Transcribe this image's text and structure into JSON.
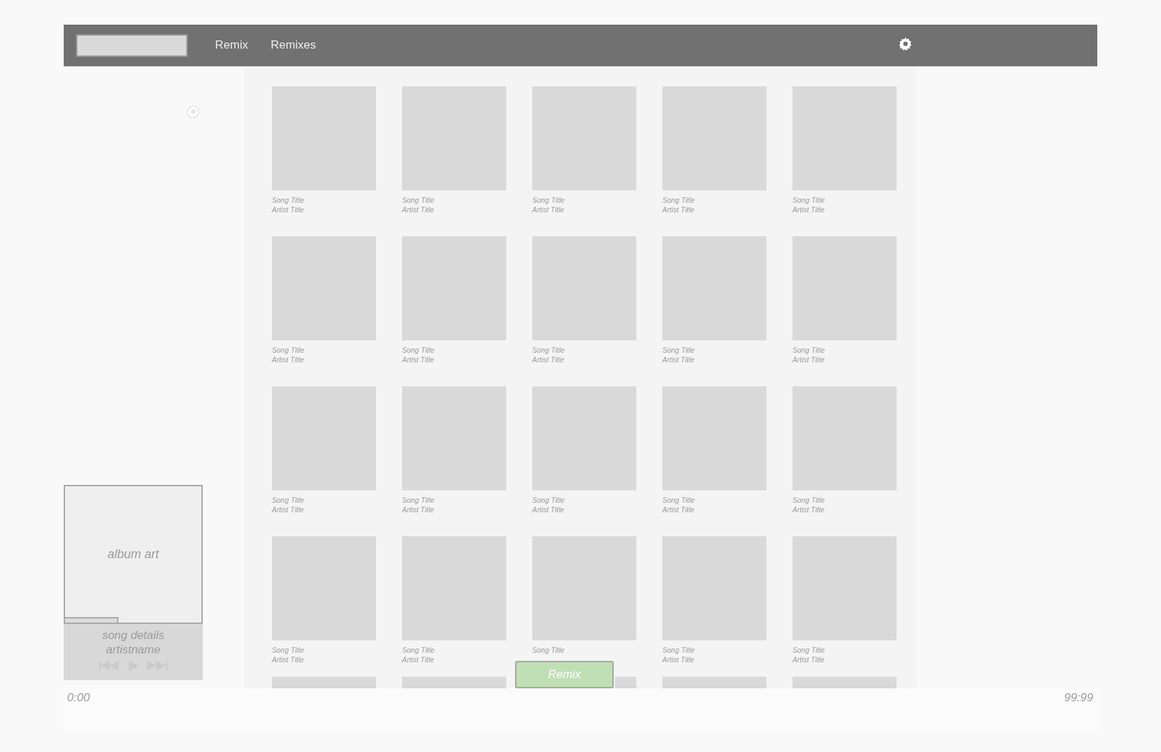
{
  "nav": {
    "items": [
      "Remix",
      "Remixes"
    ]
  },
  "player": {
    "album_art": "album art",
    "song": "song details",
    "artist": "artistname",
    "level": 0.39
  },
  "tiles": [
    {
      "kind": "song",
      "title": "Song Title",
      "artist": "Artist Title"
    },
    {
      "kind": "song",
      "title": "Song Title",
      "artist": "Artist Title"
    },
    {
      "kind": "song",
      "title": "Song Title",
      "artist": "Artist Title"
    },
    {
      "kind": "song",
      "title": "Song Title",
      "artist": "Artist Title"
    },
    {
      "kind": "song",
      "title": "Song Title",
      "artist": "Artist Title"
    },
    {
      "kind": "song",
      "title": "Song Title",
      "artist": "Artist Title"
    },
    {
      "kind": "song",
      "title": "Song Title",
      "artist": "Artist Title"
    },
    {
      "kind": "song",
      "title": "Song Title",
      "artist": "Artist Title"
    },
    {
      "kind": "song",
      "title": "Song Title",
      "artist": "Artist Title"
    },
    {
      "kind": "song",
      "title": "Song Title",
      "artist": "Artist Title"
    },
    {
      "kind": "song",
      "title": "Song Title",
      "artist": "Artist Title"
    },
    {
      "kind": "song",
      "title": "Song Title",
      "artist": "Artist Title"
    },
    {
      "kind": "song",
      "title": "Song Title",
      "artist": "Artist Title"
    },
    {
      "kind": "song",
      "title": "Song Title",
      "artist": "Artist Title"
    },
    {
      "kind": "song",
      "title": "Song Title",
      "artist": "Artist Title"
    },
    {
      "kind": "song",
      "title": "Song Title",
      "artist": "Artist Title"
    },
    {
      "kind": "song",
      "title": "Song Title",
      "artist": "Artist Title"
    },
    {
      "kind": "song",
      "title": "Song Title"
    },
    {
      "kind": "song",
      "title": "Song Title",
      "artist": "Artist Title"
    },
    {
      "kind": "song",
      "title": "Song Title",
      "artist": "Artist Title"
    },
    {
      "kind": "partial"
    },
    {
      "kind": "partial"
    },
    {
      "kind": "partial"
    },
    {
      "kind": "partial"
    },
    {
      "kind": "partial"
    }
  ],
  "remix_button": "Remix",
  "timeline": {
    "start": "0:00",
    "end": "99:99"
  }
}
